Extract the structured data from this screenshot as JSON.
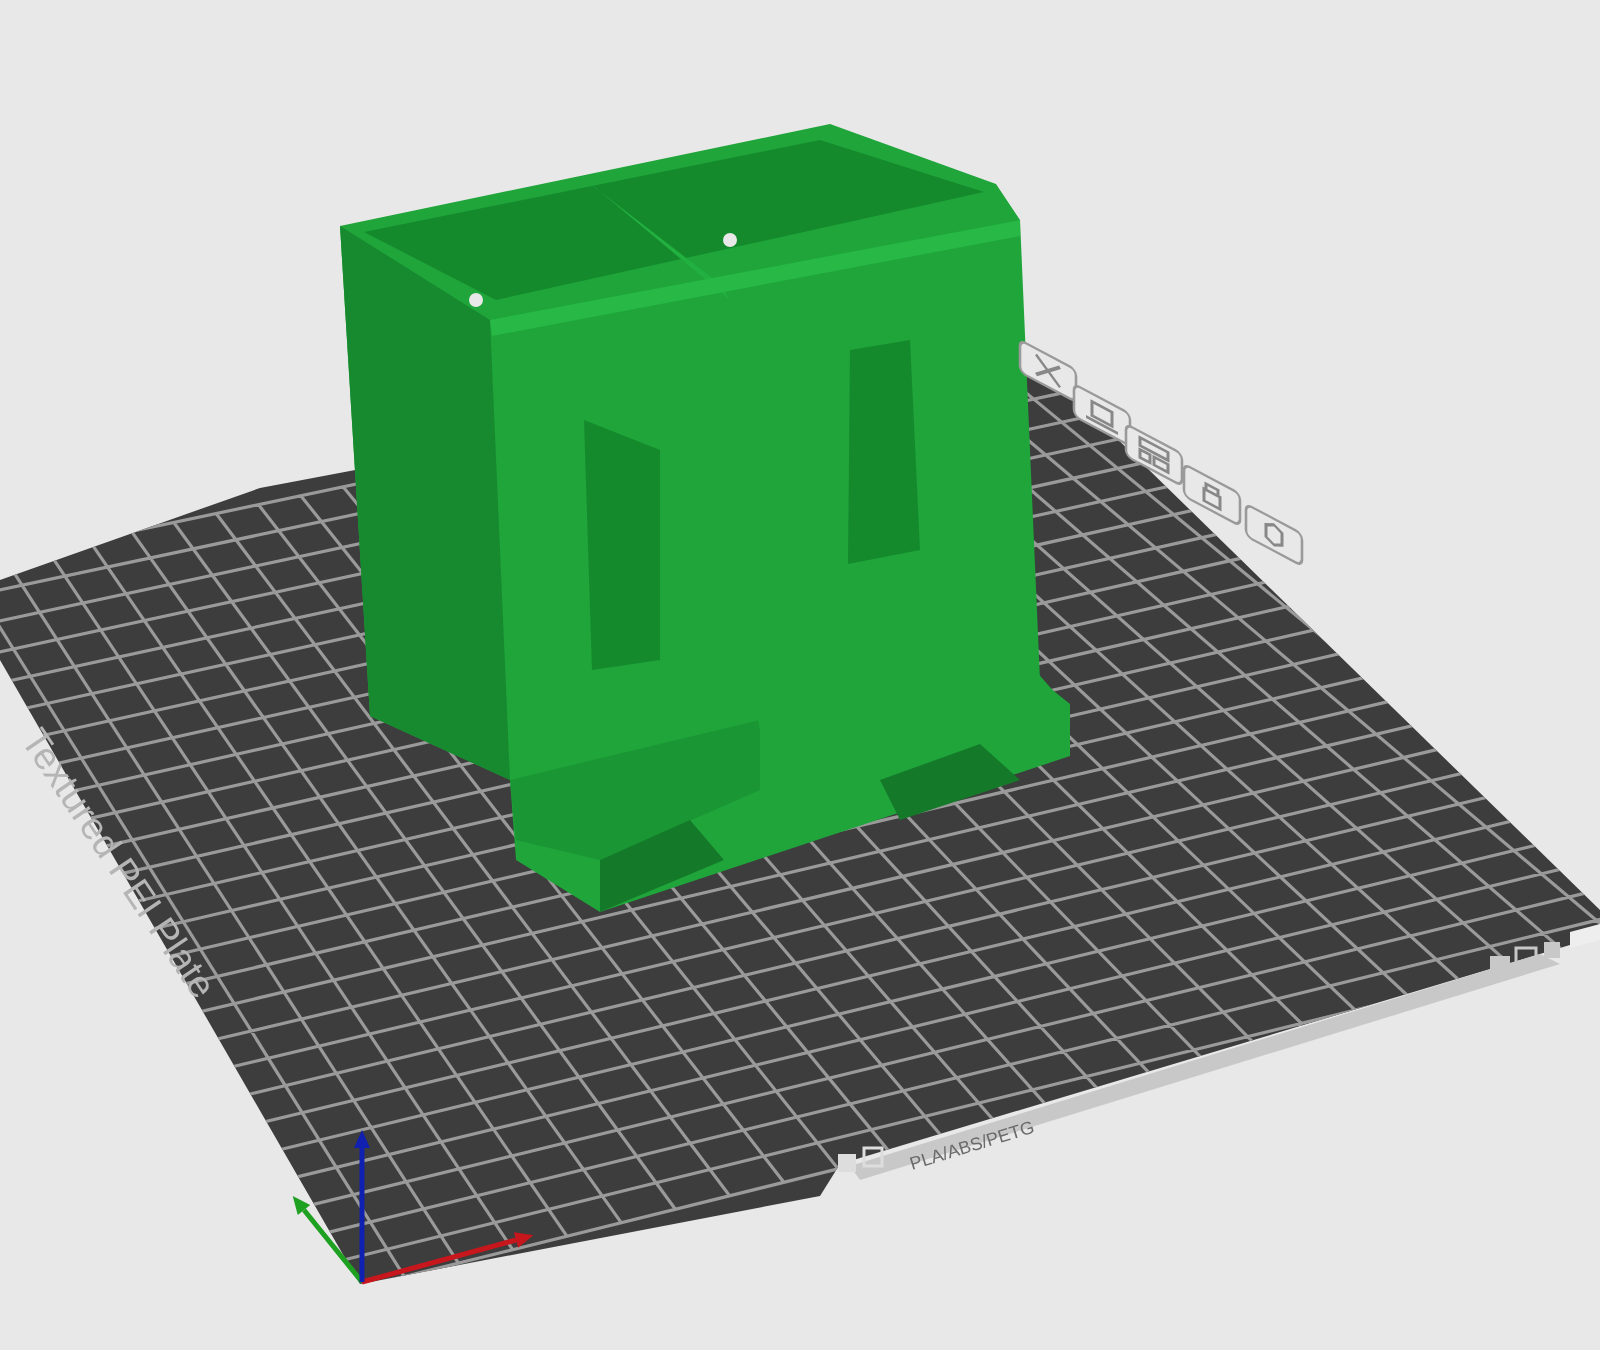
{
  "viewport": {
    "plate_name": "Textured PEI Plate",
    "filament_label": "PLA/ABS/PETG"
  }
}
